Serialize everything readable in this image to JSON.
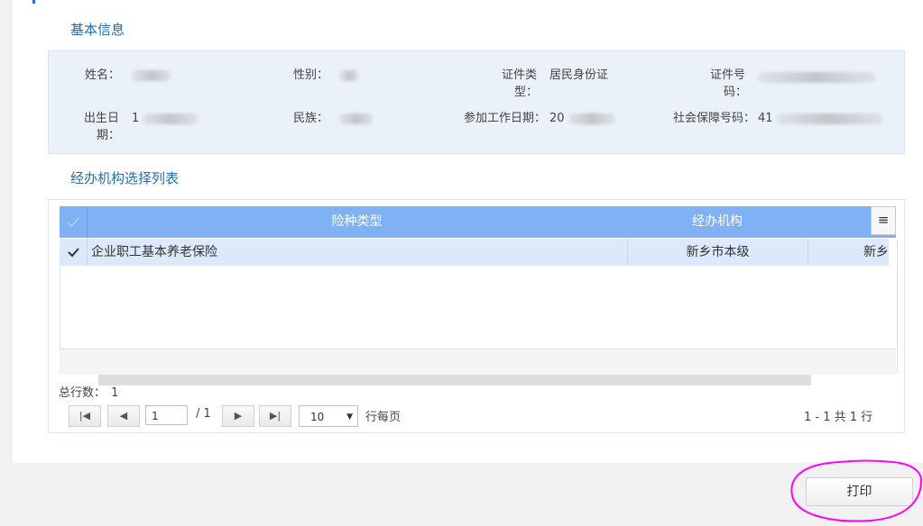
{
  "basic_info": {
    "title": "基本信息",
    "name_label": "姓名：",
    "gender_label": "性别：",
    "id_type_label_1": "证件类",
    "id_type_label_2": "型：",
    "id_type_value": "居民身份证",
    "id_no_label_1": "证件号",
    "id_no_label_2": "码：",
    "birth_label_1": "出生日",
    "birth_label_2": "期：",
    "birth_value_partial": "1",
    "ethnicity_label": "民族：",
    "work_start_label": "参加工作日期：",
    "work_start_value_partial": "20",
    "ssn_label": "社会保障号码：",
    "ssn_value_partial": "41"
  },
  "agency_list": {
    "title": "经办机构选择列表",
    "columns": [
      "险种类型",
      "经办机构"
    ],
    "menu_icon": "≡",
    "rows": [
      {
        "insurance_type": "企业职工基本养老保险",
        "agency": "新乡市本级",
        "extra": "新乡"
      }
    ]
  },
  "grid_footer": {
    "total_label": "总行数：",
    "total_value": "1"
  },
  "pager": {
    "first_icon": "first-page-icon",
    "prev_icon": "prev-page-icon",
    "next_icon": "next-page-icon",
    "last_icon": "last-page-icon",
    "current_page": "1",
    "page_sep": "/",
    "page_count": "1",
    "page_size": "10",
    "per_page_label": "行每页",
    "range_text": "1 - 1 共 1 行"
  },
  "actions": {
    "print_label": "打印"
  },
  "colors": {
    "header_blue": "#7fb1f4",
    "row_selected": "#dce9fb",
    "title_blue": "#1f6fb2",
    "highlight_magenta": "#ff00ff"
  }
}
